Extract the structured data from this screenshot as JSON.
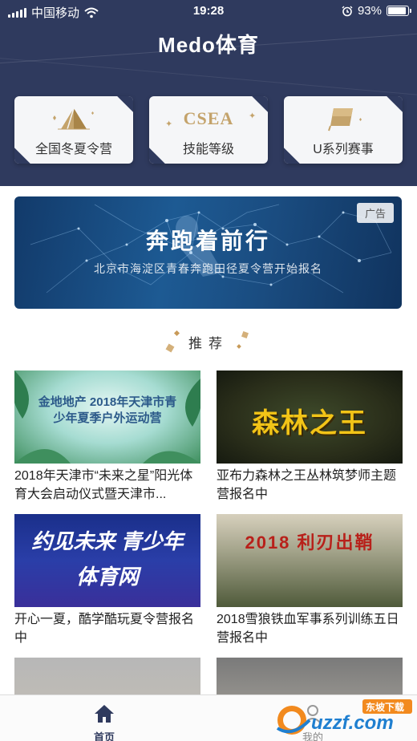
{
  "status_bar": {
    "carrier": "中国移动",
    "time": "19:28",
    "battery": "93%",
    "battery_level": 0.93
  },
  "header": {
    "app_title": "Medo体育"
  },
  "categories": [
    {
      "label": "全国冬夏令营",
      "icon": "pyramid-icon"
    },
    {
      "label": "技能等级",
      "icon": "csea-logo",
      "logo_text": "CSEA"
    },
    {
      "label": "U系列赛事",
      "icon": "flag-icon"
    }
  ],
  "banner": {
    "tag": "广告",
    "title": "奔跑着前行",
    "subtitle": "北京市海淀区青春奔跑田径夏令营开始报名"
  },
  "section": {
    "title": "推荐"
  },
  "cards": [
    {
      "title": "2018年天津市“未来之星”阳光体育大会启动仪式暨天津市...",
      "thumb_text": "金地地产 2018年天津市青少年夏季户外运动营"
    },
    {
      "title": "亚布力森林之王丛林筑梦师主题营报名中",
      "thumb_text": "森林之王"
    },
    {
      "title": "开心一夏，酷学酷玩夏令营报名中",
      "thumb_text": "约见未来 青少年体育网"
    },
    {
      "title": "2018雪狼铁血军事系列训练五日营报名中",
      "thumb_text": "2018 利刃出鞘"
    },
    {
      "title": "",
      "thumb_text": ""
    },
    {
      "title": "",
      "thumb_text": ""
    }
  ],
  "tabbar": {
    "items": [
      {
        "label": "首页",
        "icon": "home-icon",
        "active": true
      },
      {
        "label": "我的",
        "icon": "user-icon",
        "active": false
      }
    ]
  },
  "watermark": {
    "text": "uzzf.com",
    "badge": "东坡下载"
  },
  "colors": {
    "header_bg": "#2f3a5e",
    "accent_gold": "#c4a36b"
  }
}
